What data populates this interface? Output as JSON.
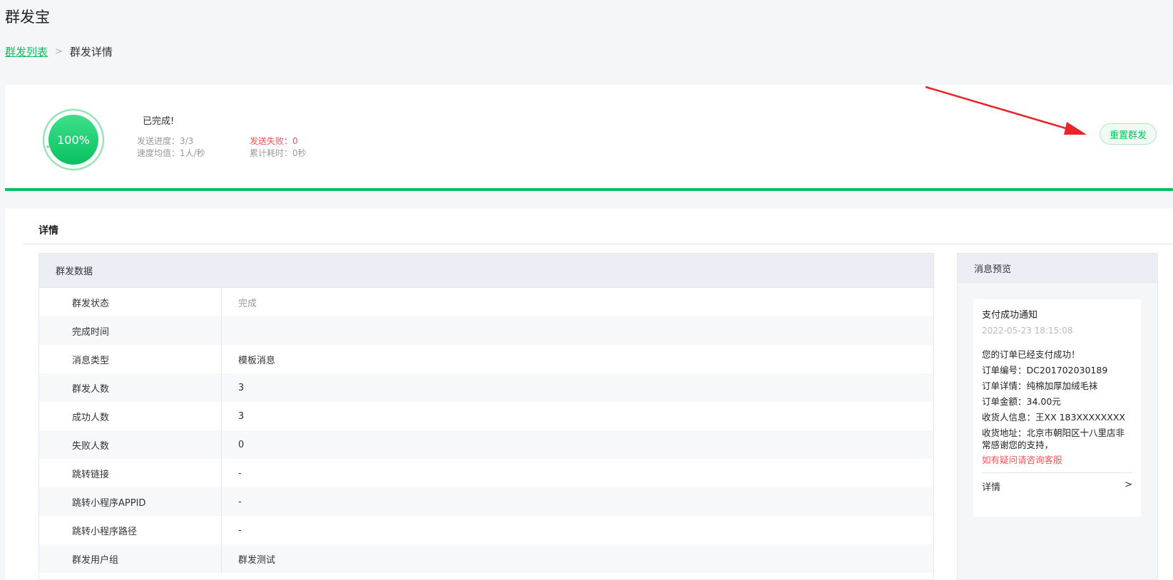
{
  "app": {
    "title": "群发宝"
  },
  "breadcrumb": {
    "parent": "群发列表",
    "separator": ">",
    "current": "群发详情"
  },
  "summary": {
    "progress_percent": 100,
    "progress_label": "100%",
    "status": "已完成!",
    "progress": "发送进度：3/3",
    "speed": "速度均值：1人/秒",
    "failed": "发送失败：0",
    "elapsed": "累计耗时：0秒",
    "reset_button": "重置群发"
  },
  "colors": {
    "brand": "#07c160",
    "danger": "#fa5151",
    "annotation_arrow": "#e8232a"
  },
  "detail": {
    "heading": "详情",
    "data_panel_title": "群发数据",
    "rows": [
      {
        "label": "群发状态",
        "value": "完成"
      },
      {
        "label": "完成时间",
        "value": ""
      },
      {
        "label": "消息类型",
        "value": "模板消息"
      },
      {
        "label": "群发人数",
        "value": "3"
      },
      {
        "label": "成功人数",
        "value": "3"
      },
      {
        "label": "失败人数",
        "value": "0"
      },
      {
        "label": "跳转链接",
        "value": "-"
      },
      {
        "label": "跳转小程序APPID",
        "value": "-"
      },
      {
        "label": "跳转小程序路径",
        "value": "-"
      },
      {
        "label": "群发用户组",
        "value": "群发测试"
      }
    ]
  },
  "preview": {
    "title": "消息预览",
    "message": {
      "title": "支付成功通知",
      "time": "2022-05-23 18:15:08",
      "greeting": "您的订单已经支付成功！",
      "order_no": "订单编号：DC201702030189",
      "order_detail": "订单详情：纯棉加厚加绒毛袜",
      "amount": "订单金额：34.00元",
      "receiver": "收货人信息：王XX 183XXXXXXXX",
      "address": "收货地址：北京市朝阳区十八里店非常感谢您的支持，",
      "contact_link": "如有疑问请咨询客服",
      "footer_label": "详情",
      "footer_arrow": ">"
    }
  }
}
